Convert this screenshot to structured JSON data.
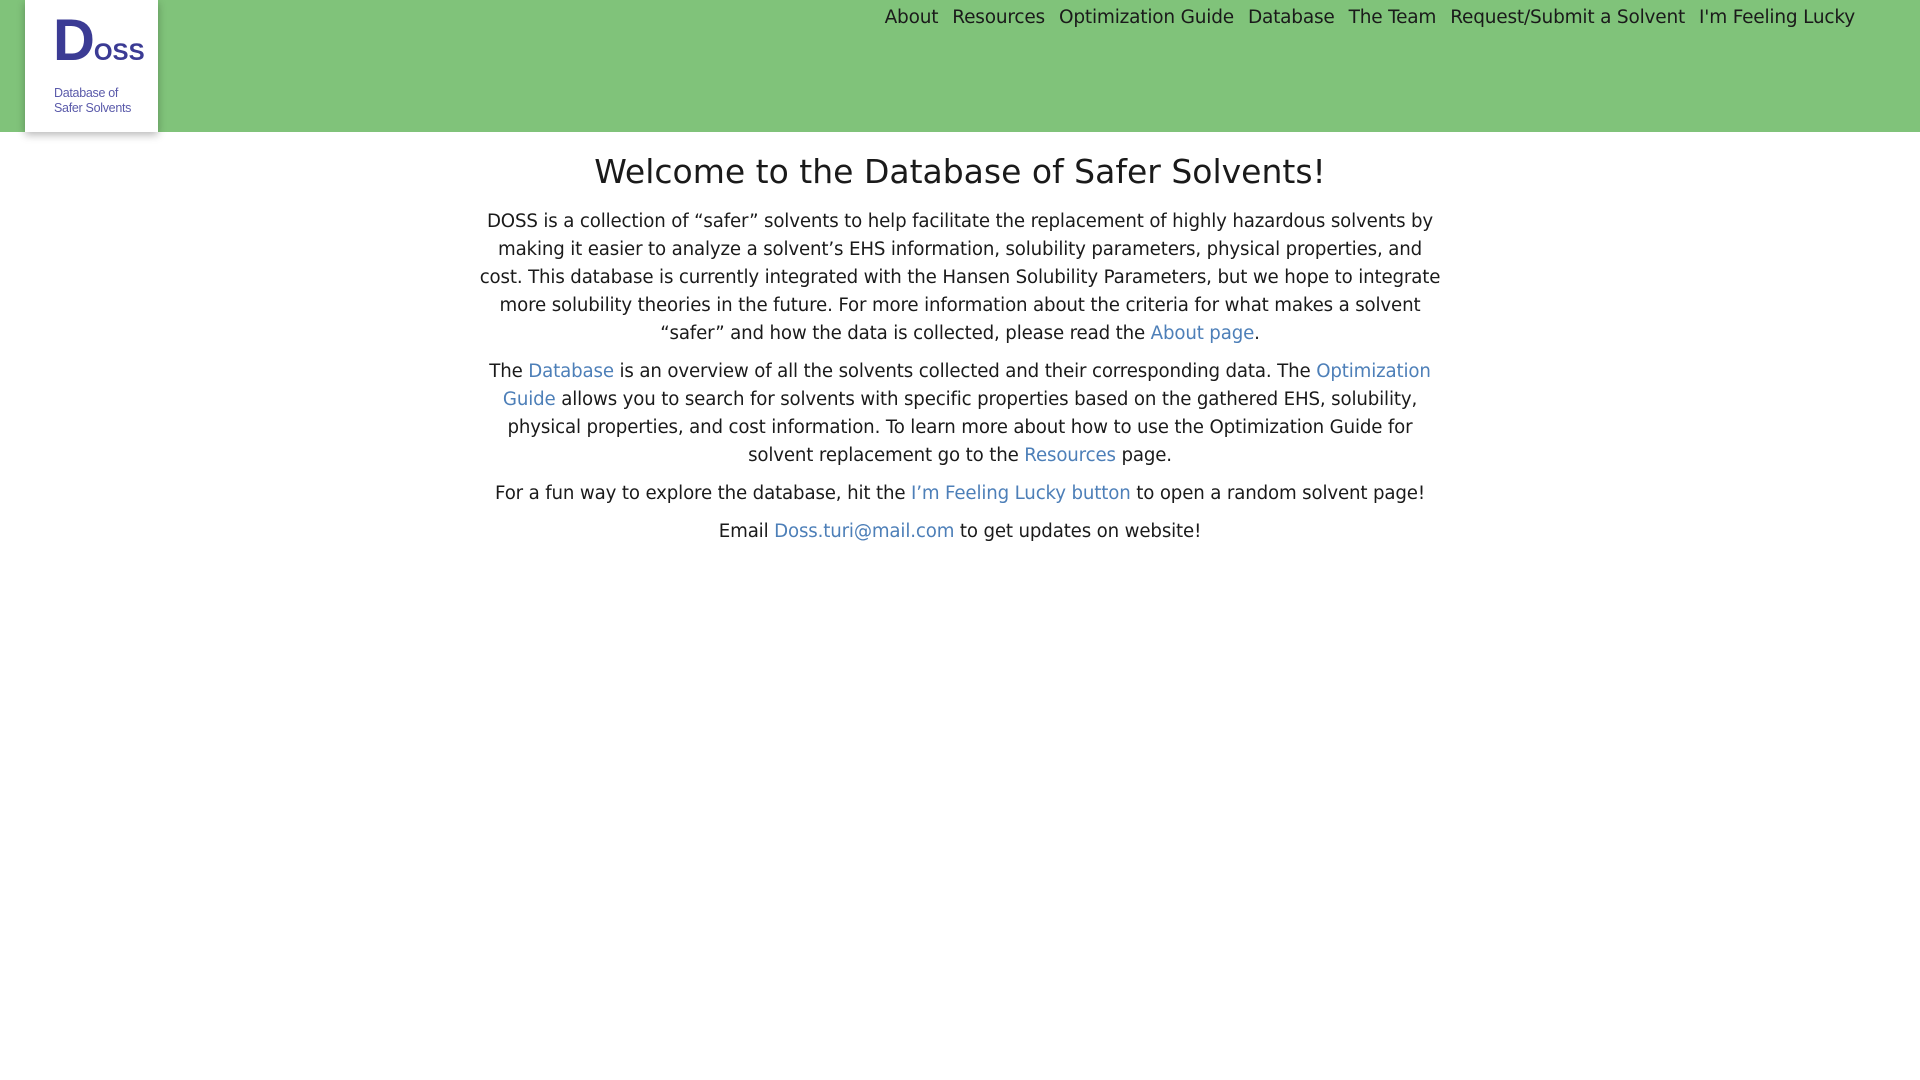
{
  "logo": {
    "mark_big": "D",
    "mark_small": "OSS",
    "sub_line1": "Database of",
    "sub_line2": "Safer Solvents"
  },
  "nav": {
    "items": [
      {
        "label": "About"
      },
      {
        "label": "Resources"
      },
      {
        "label": "Optimization Guide"
      },
      {
        "label": "Database"
      },
      {
        "label": "The Team"
      },
      {
        "label": "Request/Submit a Solvent"
      },
      {
        "label": "I'm Feeling Lucky"
      }
    ]
  },
  "main": {
    "title": "Welcome to the Database of Safer Solvents!",
    "p1": {
      "text": "DOSS is a collection of “safer” solvents to help facilitate the replacement of highly hazardous solvents by making it easier to analyze a solvent’s EHS information, solubility parameters, physical properties, and cost. This database is currently integrated with the Hansen Solubility Parameters, but we hope to integrate more solubility theories in the future. For more information about the criteria for what makes a solvent “safer” and how the data is collected, please read the ",
      "link": "About page",
      "end": "."
    },
    "p2": {
      "start": "The ",
      "link1": "Database",
      "mid1": " is an overview of all the solvents collected and their corresponding data. The ",
      "link2": "Optimization Guide",
      "mid2": " allows you to search for solvents with specific properties based on the gathered EHS, solubility, physical properties, and cost information. To learn more about how to use the Optimization Guide for solvent replacement go to the ",
      "link3": "Resources",
      "end": " page."
    },
    "p3": {
      "start": "For a fun way to explore the database, hit the ",
      "link": "I’m Feeling Lucky button",
      "end": " to open a random solvent page!"
    },
    "p4": {
      "start": "Email ",
      "link": "Doss.turi@mail.com",
      "end": " to get updates on website!"
    }
  },
  "colors": {
    "header_bg": "#80c37a",
    "link": "#4d7fb8",
    "logo": "#3b3b94"
  }
}
